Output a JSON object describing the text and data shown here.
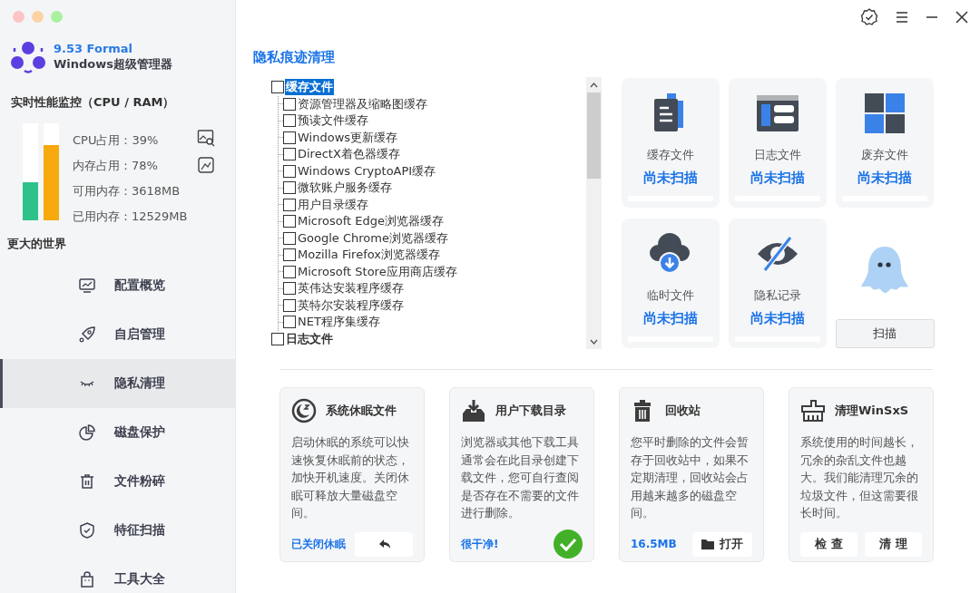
{
  "app": {
    "version": "9.53 Formal",
    "name": "Windows超级管理器"
  },
  "monitor": {
    "title": "实时性能监控（CPU / RAM）",
    "meters": [
      {
        "level": 0.39,
        "color": "#2ec28a"
      },
      {
        "level": 0.78,
        "color": "#f7a90e"
      }
    ],
    "stats": [
      "CPU占用：39%",
      "内存占用：78%",
      "可用内存：3618MB",
      "已用内存：12529MB"
    ]
  },
  "sidebar": {
    "heading": "更大的世界",
    "items": [
      {
        "label": "配置概览",
        "selected": false
      },
      {
        "label": "自启管理",
        "selected": false
      },
      {
        "label": "隐私清理",
        "selected": true
      },
      {
        "label": "磁盘保护",
        "selected": false
      },
      {
        "label": "文件粉碎",
        "selected": false
      },
      {
        "label": "特征扫描",
        "selected": false
      },
      {
        "label": "工具大全",
        "selected": false
      }
    ]
  },
  "page_title": "隐私痕迹清理",
  "tree": {
    "items": [
      {
        "label": "缓存文件",
        "checked": false,
        "selected": true,
        "children": [
          {
            "label": "资源管理器及缩略图缓存",
            "checked": false
          },
          {
            "label": "预读文件缓存",
            "checked": false
          },
          {
            "label": "Windows更新缓存",
            "checked": false
          },
          {
            "label": "DirectX着色器缓存",
            "checked": false
          },
          {
            "label": "Windows CryptoAPI缓存",
            "checked": false
          },
          {
            "label": "微软账户服务缓存",
            "checked": false
          },
          {
            "label": "用户目录缓存",
            "checked": false
          },
          {
            "label": "Microsoft Edge浏览器缓存",
            "checked": false
          },
          {
            "label": "Google Chrome浏览器缓存",
            "checked": false
          },
          {
            "label": "Mozilla Firefox浏览器缓存",
            "checked": false
          },
          {
            "label": "Microsoft Store应用商店缓存",
            "checked": false
          },
          {
            "label": "英伟达安装程序缓存",
            "checked": false
          },
          {
            "label": "英特尔安装程序缓存",
            "checked": false
          },
          {
            "label": "NET程序集缓存",
            "checked": false
          }
        ]
      },
      {
        "label": "日志文件",
        "checked": false,
        "selected": false
      }
    ]
  },
  "categories": [
    {
      "label": "缓存文件",
      "status": "尚未扫描",
      "level": 0
    },
    {
      "label": "日志文件",
      "status": "尚未扫描",
      "level": 0
    },
    {
      "label": "废弃文件",
      "status": "尚未扫描",
      "level": 0
    },
    {
      "label": "临时文件",
      "status": "尚未扫描",
      "level": 0
    },
    {
      "label": "隐私记录",
      "status": "尚未扫描",
      "level": 0
    }
  ],
  "scan_button": "扫描",
  "tools": [
    {
      "kind": "undo",
      "title": "系统休眠文件",
      "description": "启动休眠的系统可以快速恢复休眠前的状态，加快开机速度。关闭休眠可释放大量磁盘空间。",
      "status": "已关闭休眠"
    },
    {
      "kind": "done",
      "title": "用户下载目录",
      "description": "浏览器或其他下载工具通常会在此目录创建下载文件，您可自行查阅是否存在不需要的文件进行删除。",
      "status": "很干净!"
    },
    {
      "kind": "open",
      "title": "回收站",
      "description": "您平时删除的文件会暂存于回收站中，如果不定期清理，回收站会占用越来越多的磁盘空间。",
      "status": "16.5MB",
      "buttons": [
        "打开"
      ]
    },
    {
      "kind": "pair",
      "title": "清理WinSxS",
      "description": "系统使用的时间越长，冗余的杂乱文件也越大。我们能清理冗余的垃圾文件，但这需要很长时间。",
      "buttons": [
        "检 查",
        "清 理"
      ]
    }
  ]
}
